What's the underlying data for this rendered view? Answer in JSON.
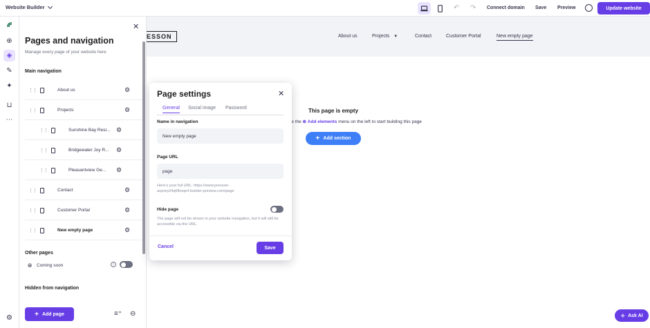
{
  "topbar": {
    "site_menu_label": "Website Builder",
    "devices": [
      "laptop-icon",
      "mobile-icon"
    ],
    "undo_icon": "undo-icon",
    "redo_icon": "redo-icon",
    "connect_domain": "Connect domain",
    "save": "Save",
    "preview": "Preview",
    "update_website": "Update website"
  },
  "rail": {
    "items": [
      "logo-icon",
      "add-element-icon",
      "layers-icon",
      "design-icon",
      "ai-tools-icon",
      "store-icon",
      "more-icon"
    ],
    "bottom_item": "settings-icon"
  },
  "pages_panel": {
    "title": "Pages and navigation",
    "subtitle": "Manage every page of your website here",
    "main_navigation_heading": "Main navigation",
    "main_navigation": [
      {
        "label": "About us"
      },
      {
        "label": "Projects"
      },
      {
        "label": "Sunshine Bay Resi..."
      },
      {
        "label": "Bridgewater Joy R..."
      },
      {
        "label": "Pleasantview Ge..."
      },
      {
        "label": "Contact"
      },
      {
        "label": "Customer Portal"
      },
      {
        "label": "New empty page"
      }
    ],
    "other_pages_heading": "Other pages",
    "other_pages": [
      {
        "label": "Coming soon"
      }
    ],
    "hidden_heading": "Hidden from navigation",
    "add_page": "Add page"
  },
  "canvas": {
    "logo_text": "ESSON",
    "nav": [
      "About us",
      "Projects",
      "Contact",
      "Customer Portal",
      "New empty page"
    ],
    "empty_title": "This page is empty",
    "empty_hint_prefix": "se the",
    "empty_hint_link": "Add elements",
    "empty_hint_suffix": "menu on the left to start building this page",
    "add_section": "Add section",
    "ask_ai": "Ask AI"
  },
  "modal": {
    "title": "Page settings",
    "tabs": [
      "General",
      "Social image",
      "Password"
    ],
    "active_tab": "General",
    "name_label": "Name in navigation",
    "name_value": "New empty page",
    "url_label": "Page URL",
    "url_value": "page",
    "url_note": "Here's your full URL: https://www.presson-aopvrp24q6fkoqe4.builder-preview.com/page",
    "hide_label": "Hide page",
    "hide_enabled": false,
    "hide_note": "The page will not be shown in your website navigation, but it will still be accessible via the URL.",
    "cancel": "Cancel",
    "save": "Save"
  },
  "colors": {
    "accent": "#673de6",
    "blue_button": "#3e7ef7",
    "header_bg": "#f2f3f6"
  }
}
